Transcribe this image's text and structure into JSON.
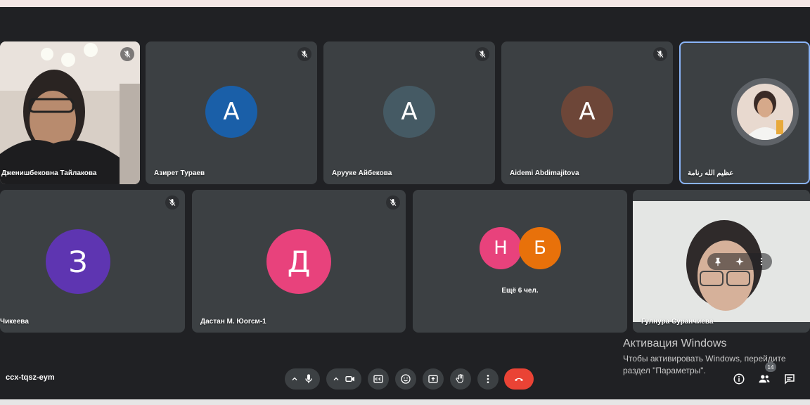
{
  "meeting": {
    "code": "ccx-tqsz-eym"
  },
  "tiles": [
    {
      "name": "Дженишбековна Тайлакова"
    },
    {
      "name": "Азирет Тураев",
      "initial": "А",
      "color": "#1a5fa8"
    },
    {
      "name": "Арууке Айбекова",
      "initial": "А",
      "color": "#455a64"
    },
    {
      "name": "Aidemi Abdimajitova",
      "initial": "А",
      "color": "#6d4638"
    },
    {
      "name": "عظيم الله رنامة"
    },
    {
      "name": "Чикеева",
      "initial": "З",
      "color": "#5e35b1"
    },
    {
      "name": "Дастан М. Юогсм-1",
      "initial": "Д",
      "color": "#e8427c"
    },
    {
      "more_label": "Ещё 6 чел.",
      "initials": [
        "Н",
        "Б"
      ],
      "colors": [
        "#e8427c",
        "#e8710a"
      ]
    },
    {
      "name": "Гулнура Суранчиева"
    }
  ],
  "activation": {
    "title": "Активация Windows",
    "line1": "Чтобы активировать Windows, перейдите",
    "line2": "раздел \"Параметры\"."
  },
  "people_count": "14",
  "end_call_color": "#ea4335"
}
